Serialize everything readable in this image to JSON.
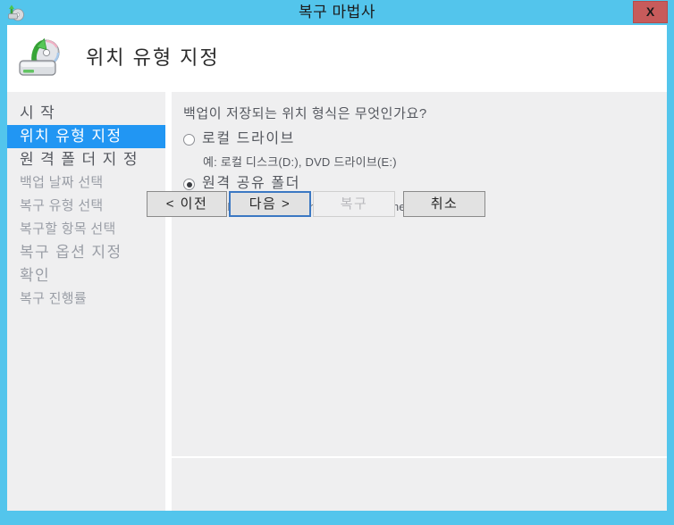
{
  "window": {
    "title": "복구 마법사",
    "title_icon": "recovery-wizard-icon",
    "close_label": "X",
    "frame_color": "#53c5ec"
  },
  "banner": {
    "icon": "restore-drive-icon",
    "page_title": "위치 유형 지정"
  },
  "sidebar": {
    "items": [
      {
        "label": "시 작",
        "state": "done"
      },
      {
        "label": "위치 유형 지정",
        "state": "active"
      },
      {
        "label": "원 격 폴 더 지 정",
        "state": "done"
      },
      {
        "label": "백업 날짜 선택",
        "state": "pending"
      },
      {
        "label": "복구 유형 선택",
        "state": "pending"
      },
      {
        "label": "복구할 항목 선택",
        "state": "pending"
      },
      {
        "label": "복구 옵션 지정",
        "state": "pending"
      },
      {
        "label": "확인",
        "state": "pending"
      },
      {
        "label": "복구 진행률",
        "state": "pending"
      }
    ]
  },
  "content": {
    "question": "백업이 저장되는 위치 형식은 무엇인가요?",
    "options": [
      {
        "label": "로컬 드라이브",
        "example": "예: 로컬 디스크(D:), DVD 드라이브(E:)",
        "selected": false
      },
      {
        "label": "원격 공유 폴더",
        "example": "예: \\\\MyFileServer\\SharedFolderName",
        "selected": true
      }
    ]
  },
  "buttons": {
    "previous": "< 이전",
    "next": "다음 >",
    "recover": "복구",
    "cancel": "취소"
  },
  "colors": {
    "accent": "#2196f3",
    "frame": "#53c5ec",
    "panel": "#efeff0",
    "close": "#c75b5b",
    "focus_border": "#3b78c3"
  }
}
